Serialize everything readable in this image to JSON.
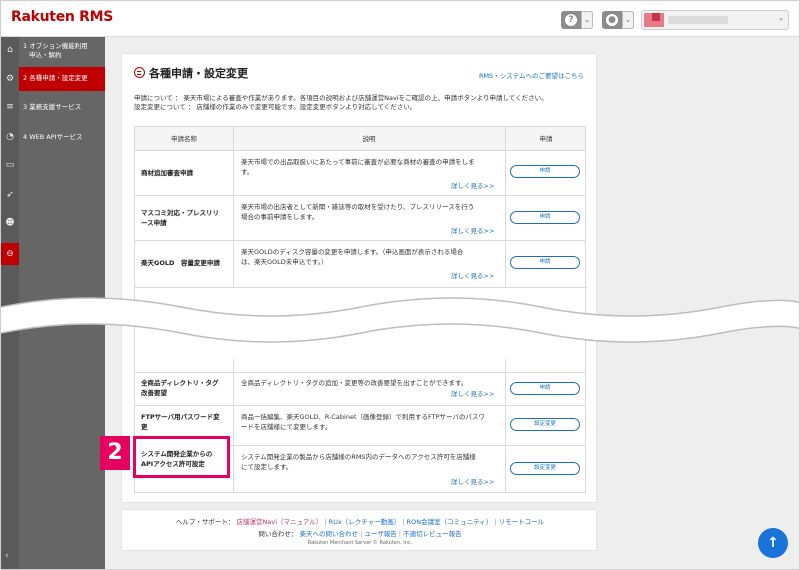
{
  "header": {
    "logo": "Rakuten RMS",
    "help_icon": "question-icon",
    "user_icon": "user-icon"
  },
  "side_menu": [
    {
      "label_line1": "1 オプション機能利用",
      "label_line2": "申込・解約"
    },
    {
      "label_line1": "2 各種申請・設定変更"
    },
    {
      "label_line1": "3 業務支援サービス"
    },
    {
      "label_line1": "4 WEB APIサービス"
    }
  ],
  "main": {
    "title": "各種申請・設定変更",
    "help_link": "RMS・システムへのご要望はこちら",
    "desc_line1": "申請について ： 楽天市場による審査や作業があります。各項目の説明および店舗運営Naviをご確認の上、申請ボタンより申請してください。",
    "desc_line2": "設定変更について ： 店舗様の作業のみで変更可能です。設定変更ボタンより対応してください。",
    "table_headers": {
      "name": "申請名称",
      "desc": "説明",
      "action": "申請"
    },
    "rows": [
      {
        "name": "商材追加審査申請",
        "text1": "楽天市場での出品取扱いにあたって事前に審査が必要な商材の審査の申請をしま",
        "text2": "す。",
        "more": "詳しく見る>>",
        "button": "申請"
      },
      {
        "name1": "マスコミ対応・プレスリリ",
        "name2": "ース申請",
        "text1": "楽天市場の出店者として新聞・雑誌等の取材を受けたり、プレスリリースを行う",
        "text2": "場合の事前申請をします。",
        "more": "詳しく見る>>",
        "button": "申請"
      },
      {
        "name": "楽天GOLD　容量変更申請",
        "text1": "楽天GOLDのディスク容量の変更を申請します。（申込画面が表示される場合",
        "text2": "は、楽天GOLD未申込です。）",
        "more": "詳しく見る>>",
        "button": "申請"
      },
      {
        "name1": "全商品ディレクトリ・タグ",
        "name2": "改善要望",
        "text1": "全商品ディレクトリ・タグの追加・変更等の改善要望を出すことができます。",
        "more": "詳しく見る>>",
        "button": "申請"
      },
      {
        "name1": "FTPサーバ用パスワード変",
        "name2": "更",
        "text1": "商品一括編集、楽天GOLD、R-Cabinet（画像登録）で利用するFTPサーバのパスワ",
        "text2": "ードを店舗様にて変更します。",
        "button": "設定変更"
      },
      {
        "name1": "システム開発企業からの",
        "name2": "APIアクセス許可設定",
        "text1": "システム開発企業の製品から店舗様のRMS内のデータへのアクセス許可を店舗様",
        "text2": "にて設定します。",
        "more": "詳しく見る>>",
        "button": "設定変更"
      }
    ]
  },
  "callout": {
    "number": "2"
  },
  "footer": {
    "help_label": "ヘルプ・サポート：",
    "link1": "店舗運営Navi（マニュアル）",
    "link2": "RUx（レクチャー動画）",
    "link3": "RON会議室（コミュニティ）",
    "link4": "リモートコール",
    "contact_label": "問い合わせ：",
    "link5": "楽天への問い合わせ",
    "link6": "ユーザ報告",
    "link7": "不適切レビュー報告",
    "copyright": "Rakuten Merchant Server © Rakuten, Inc.",
    "sep": "|"
  },
  "scroll_top_icon": "arrow-up-icon"
}
